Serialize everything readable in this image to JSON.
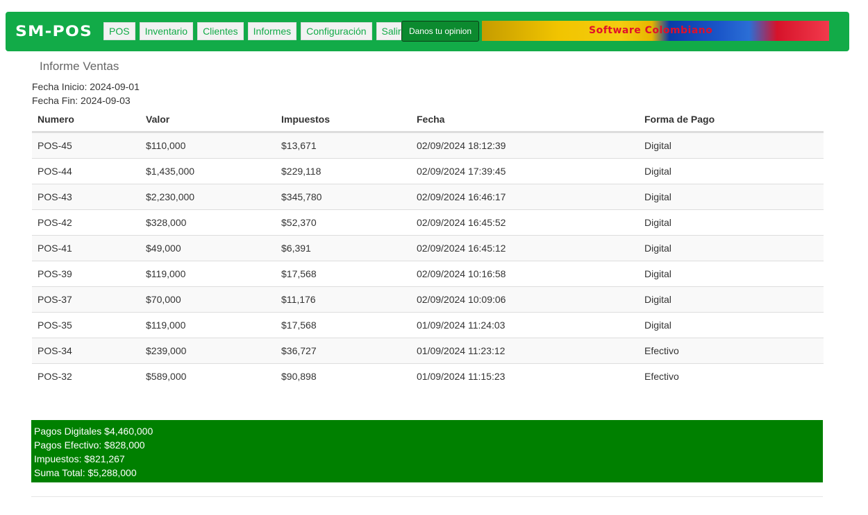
{
  "navbar": {
    "brand": "SM-POS",
    "menu": [
      {
        "label": "POS"
      },
      {
        "label": "Inventario"
      },
      {
        "label": "Clientes"
      },
      {
        "label": "Informes"
      },
      {
        "label": "Configuración"
      },
      {
        "label": "Salir"
      }
    ],
    "opinion_button": "Danos tu opinion",
    "banner_text": "Software Colombiano",
    "colors": {
      "navbar": "#12ab48",
      "opinion_button": "#0c8a2f",
      "summary": "#008000"
    }
  },
  "report": {
    "title": "Informe Ventas",
    "start_date": "Fecha Inicio: 2024-09-01",
    "end_date": "Fecha Fin: 2024-09-03"
  },
  "table": {
    "columns": [
      "Numero",
      "Valor",
      "Impuestos",
      "Fecha",
      "Forma de Pago"
    ],
    "rows": [
      [
        "POS-45",
        "$110,000",
        "$13,671",
        "02/09/2024 18:12:39",
        "Digital"
      ],
      [
        "POS-44",
        "$1,435,000",
        "$229,118",
        "02/09/2024 17:39:45",
        "Digital"
      ],
      [
        "POS-43",
        "$2,230,000",
        "$345,780",
        "02/09/2024 16:46:17",
        "Digital"
      ],
      [
        "POS-42",
        "$328,000",
        "$52,370",
        "02/09/2024 16:45:52",
        "Digital"
      ],
      [
        "POS-41",
        "$49,000",
        "$6,391",
        "02/09/2024 16:45:12",
        "Digital"
      ],
      [
        "POS-39",
        "$119,000",
        "$17,568",
        "02/09/2024 10:16:58",
        "Digital"
      ],
      [
        "POS-37",
        "$70,000",
        "$11,176",
        "02/09/2024 10:09:06",
        "Digital"
      ],
      [
        "POS-35",
        "$119,000",
        "$17,568",
        "01/09/2024 11:24:03",
        "Digital"
      ],
      [
        "POS-34",
        "$239,000",
        "$36,727",
        "01/09/2024 11:23:12",
        "Efectivo"
      ],
      [
        "POS-32",
        "$589,000",
        "$90,898",
        "01/09/2024 11:15:23",
        "Efectivo"
      ]
    ]
  },
  "summary": {
    "digital": "Pagos Digitales $4,460,000",
    "cash": "Pagos Efectivo: $828,000",
    "taxes": "Impuestos: $821,267",
    "total": "Suma Total: $5,288,000"
  }
}
